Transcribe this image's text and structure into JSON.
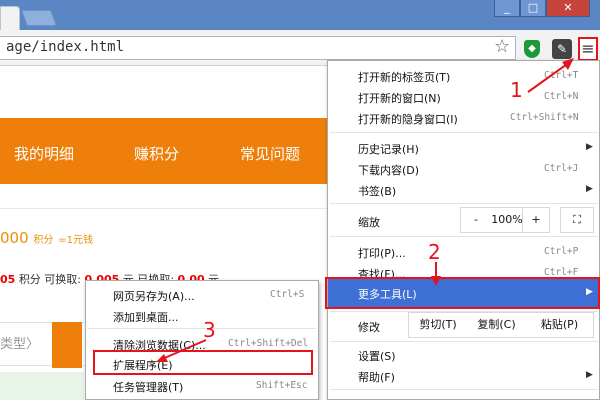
{
  "address_bar": {
    "url": "age/index.html"
  },
  "window_controls": [
    "_",
    "□",
    "✕"
  ],
  "page": {
    "nav": [
      "我的明细",
      "赚积分",
      "常见问题"
    ],
    "points_line": {
      "amount": "000",
      "unit": "积分",
      "rate": "=1元钱"
    },
    "points_detail": {
      "prefix": "05",
      "label": "积分",
      "exchange_label": "可换取:",
      "value_a": "0.005",
      "mid": "元 已换取:",
      "value_b": "0.00",
      "suffix": "元"
    },
    "left_box_label": "类型"
  },
  "menu": {
    "items": [
      {
        "label": "打开新的标签页(T)",
        "shortcut": "Ctrl+T"
      },
      {
        "label": "打开新的窗口(N)",
        "shortcut": "Ctrl+N"
      },
      {
        "label": "打开新的隐身窗口(I)",
        "shortcut": "Ctrl+Shift+N"
      },
      {
        "label": "历史记录(H)",
        "shortcut": ""
      },
      {
        "label": "下载内容(D)",
        "shortcut": "Ctrl+J"
      },
      {
        "label": "书签(B)",
        "shortcut": ""
      },
      {
        "label": "打印(P)...",
        "shortcut": "Ctrl+P"
      },
      {
        "label": "查找(F)...",
        "shortcut": "Ctrl+F"
      },
      {
        "label": "更多工具(L)",
        "shortcut": ""
      },
      {
        "label": "设置(S)",
        "shortcut": ""
      },
      {
        "label": "帮助(F)",
        "shortcut": ""
      }
    ],
    "zoom": {
      "label": "缩放",
      "minus": "-",
      "value": "100%",
      "plus": "+",
      "fullscreen": "⛶"
    },
    "edit": {
      "label": "修改",
      "cut": "剪切(T)",
      "copy": "复制(C)",
      "paste": "粘贴(P)"
    }
  },
  "submenu": {
    "items": [
      {
        "label": "网页另存为(A)...",
        "shortcut": "Ctrl+S"
      },
      {
        "label": "添加到桌面...",
        "shortcut": ""
      },
      {
        "label": "清除浏览数据(C)...",
        "shortcut": "Ctrl+Shift+Del"
      },
      {
        "label": "扩展程序(E)",
        "shortcut": ""
      },
      {
        "label": "任务管理器(T)",
        "shortcut": "Shift+Esc"
      }
    ]
  },
  "annotations": [
    "1",
    "2",
    "3"
  ],
  "colors": {
    "accent_orange": "#ee7f0b",
    "highlight_blue": "#3d6fd5",
    "annotation_red": "#e4141b"
  }
}
